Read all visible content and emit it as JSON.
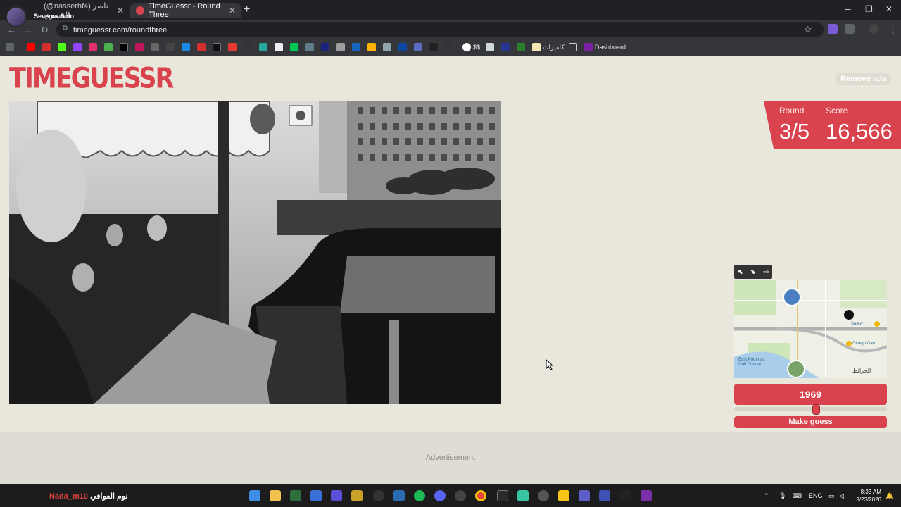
{
  "browser": {
    "profile_name": "Severus Solo",
    "tabs": [
      {
        "title": "(@nasserhf4) ناصر الشمري",
        "active": false
      },
      {
        "title": "TimeGuessr - Round Three",
        "active": true
      }
    ],
    "url": "timeguessr.com/roundthree",
    "bookmarks": {
      "folder_label": "كاميرات",
      "dashboard_label": "Dashboard",
      "dollar_label": "$$"
    }
  },
  "page": {
    "logo": "TIMEGUESSR",
    "remove_ads_label": "Remove ads",
    "round_label": "Round",
    "round_value": "3/5",
    "score_label": "Score",
    "score_value": "16,566",
    "map": {
      "labels": [
        "Safew",
        "Ginkgo Gard",
        "East Potomac Golf Course",
        "الخرائط"
      ]
    },
    "year_value": "1969",
    "slider_fraction": 0.54,
    "make_guess_label": "Make guess",
    "advertisement_label": "Advertisement"
  },
  "colors": {
    "accent": "#d9434e",
    "page_bg": "#e9e7dc"
  },
  "taskbar": {
    "user_label_red": "Nada_m10",
    "user_label_white": "نوم العوافي",
    "lang": "ENG",
    "time": "8:33 AM",
    "date": "3/23/2026"
  }
}
